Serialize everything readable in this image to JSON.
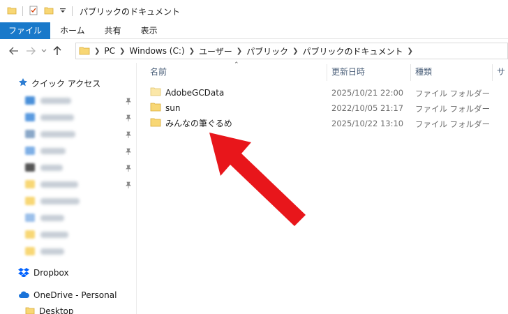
{
  "window": {
    "title": "パブリックのドキュメント"
  },
  "ribbon": {
    "tabs": [
      "ファイル",
      "ホーム",
      "共有",
      "表示"
    ]
  },
  "address": {
    "segments": [
      "PC",
      "Windows (C:)",
      "ユーザー",
      "パブリック",
      "パブリックのドキュメント"
    ]
  },
  "navpane": {
    "quick_access_label": "クイック アクセス",
    "dropbox_label": "Dropbox",
    "onedrive_label": "OneDrive - Personal",
    "desktop_label": "Desktop"
  },
  "columns": {
    "name": "名前",
    "date": "更新日時",
    "type": "種類",
    "size": "サ"
  },
  "files": [
    {
      "name": "AdobeGCData",
      "date": "2025/10/21 22:00",
      "type": "ファイル フォルダー"
    },
    {
      "name": "sun",
      "date": "2022/10/05 21:17",
      "type": "ファイル フォルダー"
    },
    {
      "name": "みんなの筆ぐるめ",
      "date": "2025/10/22 13:10",
      "type": "ファイル フォルダー"
    }
  ],
  "colors": {
    "accent": "#1979ca",
    "folder": "#f8d775",
    "arrow": "#e8161b"
  },
  "icons": [
    "folder-icon",
    "checkmark-doc-icon",
    "dropdown-icon",
    "back-arrow-icon",
    "forward-arrow-icon",
    "recent-chevron-icon",
    "up-arrow-icon",
    "star-icon",
    "pin-icon",
    "dropbox-icon",
    "cloud-icon"
  ]
}
